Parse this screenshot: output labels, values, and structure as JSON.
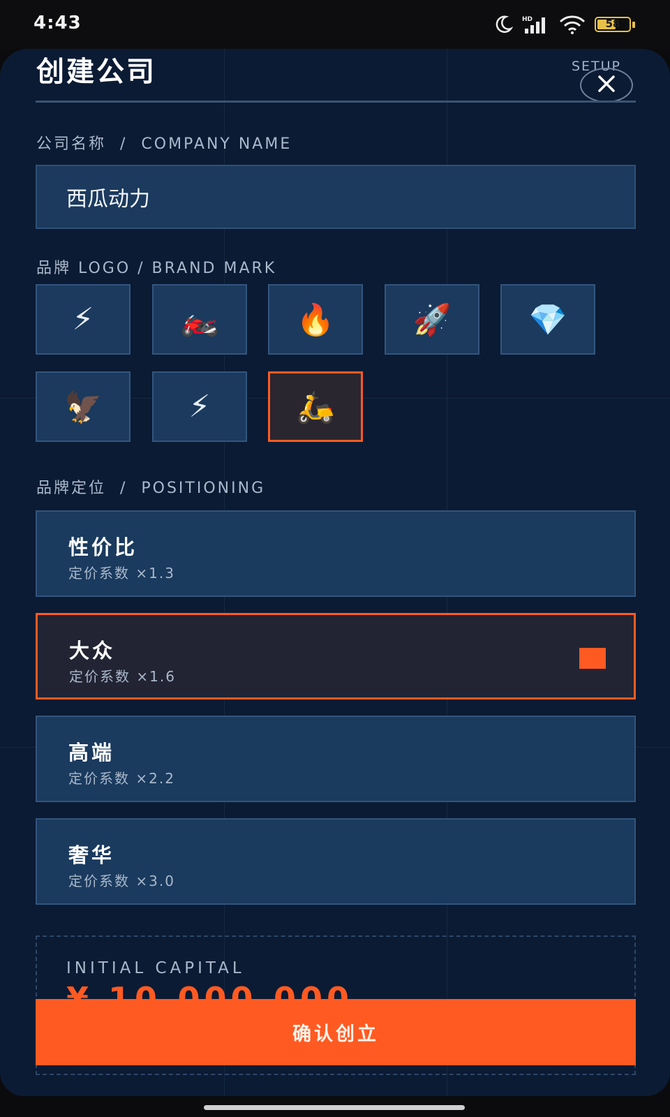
{
  "status_bar": {
    "time": "4:43",
    "battery": "58",
    "battery_level": 0.58
  },
  "header": {
    "title": "创建公司",
    "setup_label": "SETUP",
    "close_icon": "close-icon"
  },
  "company_name": {
    "label": "公司名称  /  COMPANY NAME",
    "value": "西瓜动力"
  },
  "brand_logo": {
    "label": "品牌 LOGO / BRAND MARK",
    "options": [
      {
        "glyph": "⚡",
        "icon": "lightning-icon"
      },
      {
        "glyph": "🏍️",
        "icon": "motorcycle-icon"
      },
      {
        "glyph": "🔥",
        "icon": "fire-icon"
      },
      {
        "glyph": "🚀",
        "icon": "rocket-icon"
      },
      {
        "glyph": "💎",
        "icon": "diamond-icon"
      },
      {
        "glyph": "🦅",
        "icon": "eagle-icon"
      },
      {
        "glyph": "⚡",
        "icon": "lightning-icon"
      },
      {
        "glyph": "🛵",
        "icon": "scooter-icon"
      }
    ],
    "selected_index": 7
  },
  "positioning": {
    "label": "品牌定位  /  POSITIONING",
    "options": [
      {
        "name": "性价比",
        "coefficient": "定价系数 ×1.3"
      },
      {
        "name": "大众",
        "coefficient": "定价系数 ×1.6"
      },
      {
        "name": "高端",
        "coefficient": "定价系数 ×2.2"
      },
      {
        "name": "奢华",
        "coefficient": "定价系数 ×3.0"
      }
    ],
    "selected_index": 1
  },
  "capital": {
    "label": "INITIAL CAPITAL",
    "value": "¥ 10,000,000"
  },
  "confirm_button": {
    "label": "确认创立"
  },
  "colors": {
    "accent": "#ff5a22",
    "panel": "#0b1b33",
    "card": "#1b3a5e"
  }
}
